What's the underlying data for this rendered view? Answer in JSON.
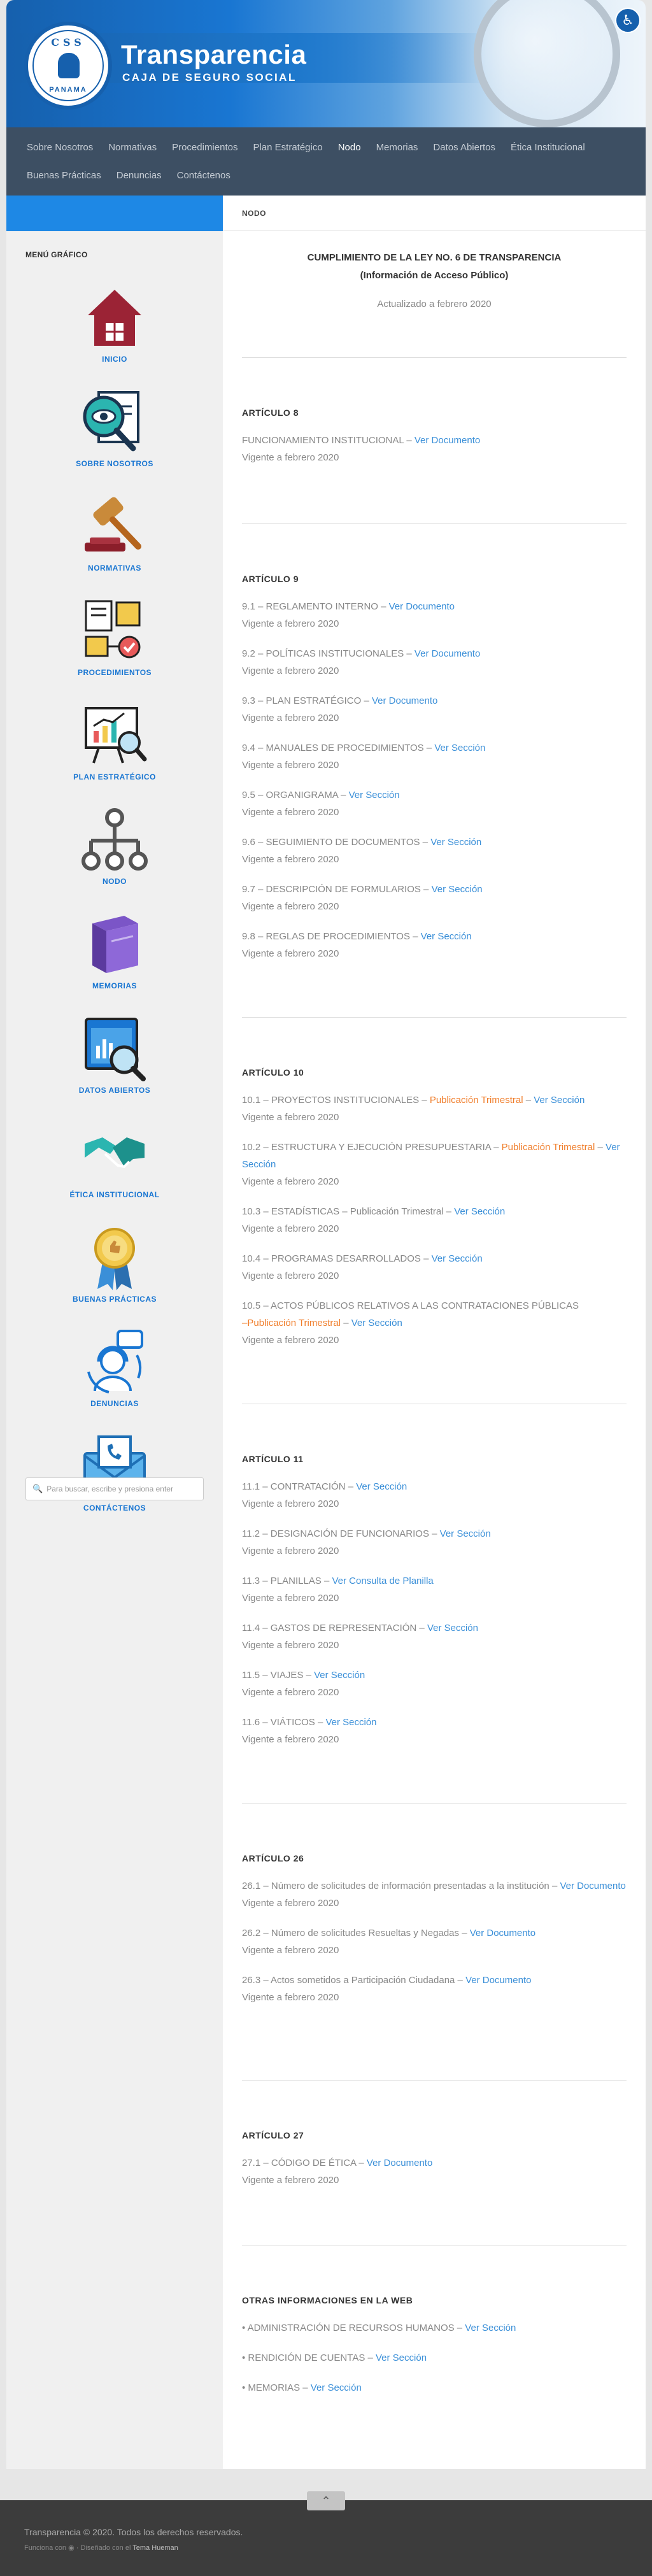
{
  "header": {
    "title": "Transparencia",
    "subtitle": "CAJA DE SEGURO SOCIAL",
    "logo_top": "CSS",
    "logo_bottom": "PANAMA"
  },
  "nav": {
    "row1": [
      "Sobre Nosotros",
      "Normativas",
      "Procedimientos",
      "Plan Estratégico",
      "Nodo",
      "Memorias",
      "Datos Abiertos",
      "Ética Institucional"
    ],
    "row2": [
      "Buenas Prácticas",
      "Denuncias",
      "Contáctenos"
    ],
    "active": "Nodo"
  },
  "breadcrumb": "NODO",
  "sidebar": {
    "title": "MENÚ GRÁFICO",
    "items": [
      {
        "label": "INICIO",
        "icon": "home-icon"
      },
      {
        "label": "SOBRE NOSOTROS",
        "icon": "magnifier-document-icon"
      },
      {
        "label": "NORMATIVAS",
        "icon": "gavel-icon"
      },
      {
        "label": "PROCEDIMIENTOS",
        "icon": "process-flow-icon"
      },
      {
        "label": "PLAN ESTRATÉGICO",
        "icon": "chart-board-icon"
      },
      {
        "label": "NODO",
        "icon": "node-tree-icon"
      },
      {
        "label": "MEMORIAS",
        "icon": "book-icon"
      },
      {
        "label": "DATOS ABIERTOS",
        "icon": "data-screen-icon"
      },
      {
        "label": "ÉTICA INSTITUCIONAL",
        "icon": "handshake-icon"
      },
      {
        "label": "BUENAS PRÁCTICAS",
        "icon": "award-icon"
      },
      {
        "label": "DENUNCIAS",
        "icon": "support-agent-icon"
      },
      {
        "label": "CONTÁCTENOS",
        "icon": "envelope-phone-icon"
      }
    ],
    "search_placeholder": "Para buscar, escribe y presiona enter"
  },
  "intro": {
    "title_line1": "CUMPLIMIENTO DE LA LEY NO. 6 DE TRANSPARENCIA",
    "title_line2": "(Información de Acceso Público)",
    "updated": "Actualizado a febrero 2020"
  },
  "sections": {
    "art8": {
      "title": "ARTÍCULO 8",
      "entries": [
        {
          "text": "FUNCIONAMIENTO INSTITUCIONAL – ",
          "link": "Ver Documento",
          "valid": "Vigente a febrero 2020"
        }
      ]
    },
    "art9": {
      "title": "ARTÍCULO 9",
      "entries": [
        {
          "text": "9.1 – REGLAMENTO INTERNO – ",
          "link": "Ver Documento",
          "valid": "Vigente a febrero 2020"
        },
        {
          "text": "9.2 – POLÍTICAS INSTITUCIONALES – ",
          "link": "Ver Documento",
          "valid": "Vigente a febrero 2020"
        },
        {
          "text": "9.3 – PLAN ESTRATÉGICO – ",
          "link": "Ver Documento",
          "valid": "Vigente a febrero 2020"
        },
        {
          "text": "9.4 – MANUALES DE PROCEDIMIENTOS – ",
          "link": "Ver Sección",
          "valid": "Vigente a febrero 2020"
        },
        {
          "text": "9.5 – ORGANIGRAMA – ",
          "link": "Ver Sección",
          "valid": "Vigente a febrero 2020"
        },
        {
          "text": "9.6 – SEGUIMIENTO DE DOCUMENTOS – ",
          "link": "Ver Sección",
          "valid": "Vigente a febrero 2020"
        },
        {
          "text": "9.7 – DESCRIPCIÓN DE FORMULARIOS – ",
          "link": "Ver Sección",
          "valid": "Vigente a febrero 2020"
        },
        {
          "text": "9.8 – REGLAS DE PROCEDIMIENTOS – ",
          "link": "Ver Sección",
          "valid": "Vigente a febrero 2020"
        }
      ]
    },
    "art10": {
      "title": "ARTÍCULO 10",
      "e1": {
        "text": "10.1 – PROYECTOS INSTITUCIONALES – ",
        "orange": "Publicación Trimestral",
        "sep": " – ",
        "link": "Ver Sección",
        "valid": "Vigente a febrero 2020"
      },
      "e2": {
        "text": "10.2 – ESTRUCTURA Y EJECUCIÓN PRESUPUESTARIA – ",
        "orange": "Publicación Trimestral",
        "sep": " – ",
        "link": "Ver Sección",
        "valid": "Vigente a febrero 2020"
      },
      "e3": {
        "text": "10.3 – ESTADÍSTICAS – Publicación Trimestral – ",
        "link": "Ver Sección",
        "valid": "Vigente a febrero 2020"
      },
      "e4": {
        "text": "10.4 – PROGRAMAS DESARROLLADOS – ",
        "link": "Ver Sección",
        "valid": "Vigente a febrero 2020"
      },
      "e5": {
        "text": "10.5 – ACTOS PÚBLICOS RELATIVOS A LAS CONTRATACIONES PÚBLICAS",
        "orange": "–Publicación Trimestral",
        "sep": " – ",
        "link": "Ver Sección",
        "valid": "Vigente a febrero 2020"
      }
    },
    "art11": {
      "title": "ARTÍCULO 11",
      "entries": [
        {
          "text": "11.1 – CONTRATACIÓN – ",
          "link": "Ver Sección",
          "valid": "Vigente a febrero 2020"
        },
        {
          "text": "11.2 – DESIGNACIÓN DE FUNCIONARIOS – ",
          "link": "Ver Sección",
          "valid": "Vigente a febrero 2020"
        },
        {
          "text": "11.3 – PLANILLAS – ",
          "link": "Ver Consulta de Planilla",
          "valid": "Vigente a febrero 2020"
        },
        {
          "text": "11.4 – GASTOS DE REPRESENTACIÓN – ",
          "link": "Ver Sección",
          "valid": "Vigente a febrero 2020"
        },
        {
          "text": "11.5 – VIAJES – ",
          "link": "Ver Sección",
          "valid": "Vigente a febrero 2020"
        },
        {
          "text": "11.6 – VIÁTICOS – ",
          "link": "Ver Sección",
          "valid": "Vigente a febrero 2020"
        }
      ]
    },
    "art26": {
      "title": "ARTÍCULO 26",
      "entries": [
        {
          "text": "26.1 – Número de solicitudes de información presentadas a la institución – ",
          "link": "Ver Documento",
          "valid": "Vigente a febrero 2020"
        },
        {
          "text": "26.2 – Número de solicitudes Resueltas y Negadas – ",
          "link": "Ver Documento",
          "valid": "Vigente a febrero 2020"
        },
        {
          "text": "26.3 – Actos sometidos a Participación Ciudadana – ",
          "link": "Ver Documento",
          "valid": "Vigente a febrero 2020"
        }
      ]
    },
    "art27": {
      "title": "ARTÍCULO 27",
      "entries": [
        {
          "text": "27.1 – CÓDIGO DE ÉTICA – ",
          "link": "Ver Documento",
          "valid": "Vigente a febrero 2020"
        }
      ]
    },
    "otras": {
      "title": "OTRAS INFORMACIONES EN LA WEB",
      "entries": [
        {
          "text": "• ADMINISTRACIÓN DE RECURSOS HUMANOS – ",
          "link": "Ver Sección"
        },
        {
          "text": "• RENDICIÓN DE CUENTAS – ",
          "link": "Ver Sección"
        },
        {
          "text": "• MEMORIAS – ",
          "link": "Ver Sección"
        }
      ]
    }
  },
  "footer": {
    "copyright": "Transparencia © 2020. Todos los derechos reservados.",
    "powered": "Funciona con",
    "designed": "· Diseñado con el",
    "theme": "Tema Hueman"
  },
  "colors": {
    "accent": "#1e88e5",
    "link": "#3a8fd8",
    "orange": "#f07d2a",
    "nav_bg": "#3d4f63"
  }
}
